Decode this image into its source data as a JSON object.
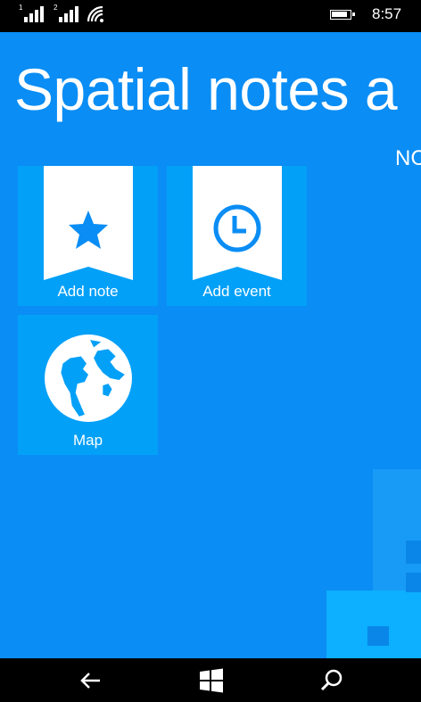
{
  "status_bar": {
    "sim1_label": "1",
    "sim2_label": "2",
    "time": "8:57",
    "icons": [
      "signal-icon",
      "signal-icon",
      "wifi-icon",
      "battery-icon"
    ]
  },
  "app": {
    "title": "Spatial notes a",
    "pivot_header": "NC",
    "background_color": "#0a8df4",
    "tile_color": "#03a0f8"
  },
  "tiles": [
    {
      "label": "Add note",
      "icon": "star-icon"
    },
    {
      "label": "Add event",
      "icon": "clock-icon"
    },
    {
      "label": "Map",
      "icon": "globe-icon"
    }
  ],
  "nav_bar": {
    "icons": [
      "back-arrow-icon",
      "windows-logo-icon",
      "search-icon"
    ]
  }
}
